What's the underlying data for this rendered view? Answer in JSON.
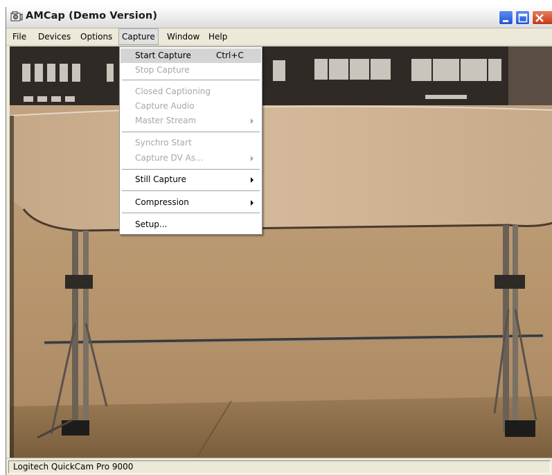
{
  "window": {
    "title": "AMCap (Demo Version)"
  },
  "menubar": {
    "items": [
      "File",
      "Devices",
      "Options",
      "Capture",
      "Window",
      "Help"
    ],
    "active": "Capture"
  },
  "capture_menu": {
    "items": [
      {
        "label": "Start Capture",
        "shortcut": "Ctrl+C",
        "enabled": true,
        "highlighted": true,
        "submenu": false
      },
      {
        "label": "Stop Capture",
        "enabled": false,
        "submenu": false
      },
      {
        "separator": true
      },
      {
        "label": "Closed Captioning",
        "enabled": false,
        "submenu": false
      },
      {
        "label": "Capture Audio",
        "enabled": false,
        "submenu": false
      },
      {
        "label": "Master Stream",
        "enabled": false,
        "submenu": true
      },
      {
        "separator": true
      },
      {
        "label": "Synchro Start",
        "enabled": false,
        "submenu": false
      },
      {
        "label": "Capture DV As...",
        "enabled": false,
        "submenu": true
      },
      {
        "separator": true
      },
      {
        "label": "Still Capture",
        "enabled": true,
        "submenu": true
      },
      {
        "separator": true
      },
      {
        "label": "Compression",
        "enabled": true,
        "submenu": true
      },
      {
        "separator": true
      },
      {
        "label": "Setup...",
        "enabled": true,
        "submenu": false
      }
    ]
  },
  "statusbar": {
    "text": "Logitech QuickCam Pro 9000"
  },
  "colors": {
    "menu_highlight": "#d4d4d4",
    "disabled_text": "#a7a7a7",
    "close_button": "#d2532f",
    "title_buttons": "#3a6fe2"
  },
  "icons": {
    "app": "camera-icon",
    "minimize": "minimize-icon",
    "maximize": "maximize-icon",
    "close": "close-icon",
    "submenu": "submenu-arrow-icon"
  }
}
